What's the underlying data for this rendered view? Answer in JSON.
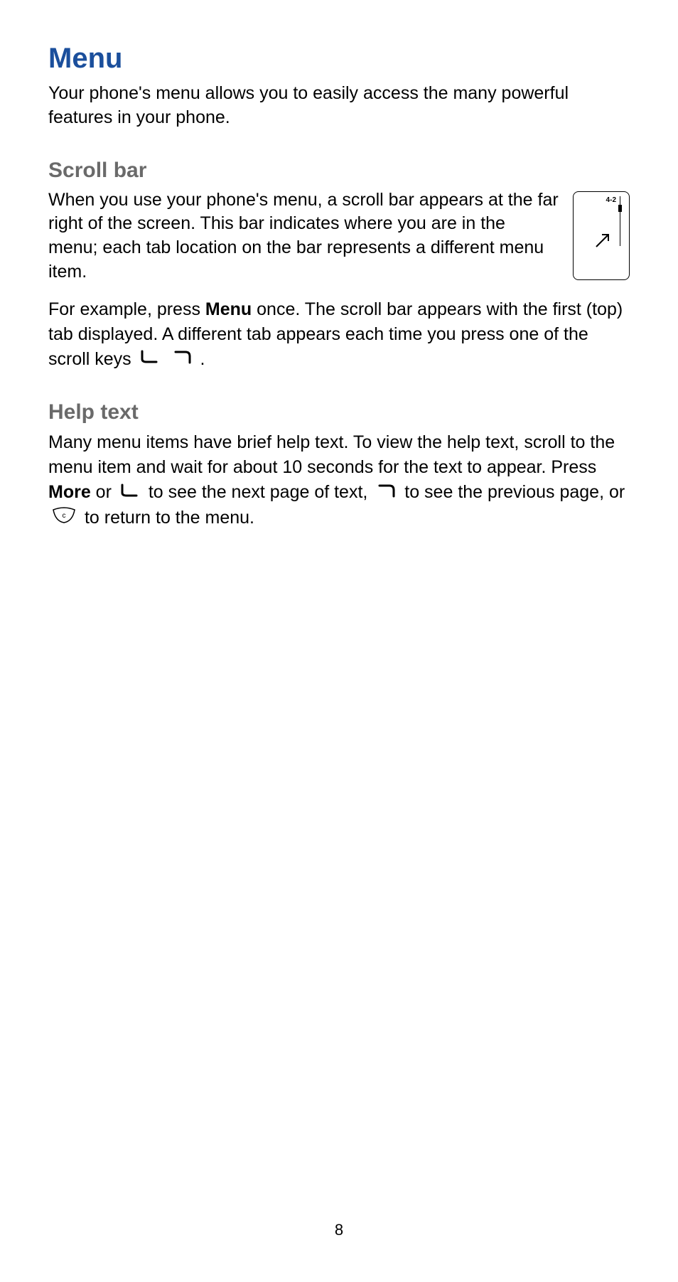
{
  "title": "Menu",
  "intro": "Your phone's menu allows you to easily access the many powerful features in your phone.",
  "scrollbar": {
    "heading": "Scroll bar",
    "body": "When you use your phone's menu, a scroll bar appears at the far right of the screen. This bar indicates where you are in the menu; each tab location on the bar represents a different menu item.",
    "screen_label": "4-2",
    "example_pre": "For example, press ",
    "example_menu": "Menu",
    "example_mid": " once. The scroll bar appears with the first (top) tab displayed. A different tab appears each time you press one of the scroll keys ",
    "example_post": " ."
  },
  "helptext": {
    "heading": "Help text",
    "p1": "Many menu items have brief help text. To view the help text, scroll to the menu item and wait for about 10 seconds for the text to appear. Press ",
    "more": "More",
    "p2": " or ",
    "p3": " to see the next page of text, ",
    "p4": " to see the previous page, or ",
    "p5": " to return to the menu."
  },
  "page_number": "8"
}
